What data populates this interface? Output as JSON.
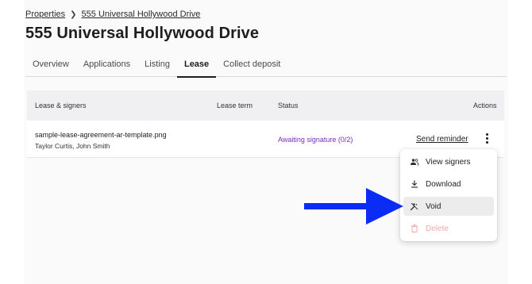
{
  "breadcrumb": {
    "parent": "Properties",
    "current": "555 Universal Hollywood Drive"
  },
  "page": {
    "title": "555 Universal Hollywood Drive"
  },
  "tabs": [
    {
      "label": "Overview",
      "active": false
    },
    {
      "label": "Applications",
      "active": false
    },
    {
      "label": "Listing",
      "active": false
    },
    {
      "label": "Lease",
      "active": true
    },
    {
      "label": "Collect deposit",
      "active": false
    }
  ],
  "table": {
    "headers": {
      "lease_signers": "Lease & signers",
      "lease_term": "Lease term",
      "status": "Status",
      "actions": "Actions"
    },
    "rows": [
      {
        "file_name": "sample-lease-agreement-ar-template.png",
        "signers": "Taylor Curtis, John Smith",
        "lease_term": "",
        "status": "Awaiting signature (0/2)",
        "action_label": "Send reminder"
      }
    ]
  },
  "menu": {
    "items": [
      {
        "label": "View signers",
        "icon": "people-icon",
        "disabled": false
      },
      {
        "label": "Download",
        "icon": "download-icon",
        "disabled": false
      },
      {
        "label": "Void",
        "icon": "void-icon",
        "disabled": false,
        "highlighted": true
      },
      {
        "label": "Delete",
        "icon": "trash-icon",
        "disabled": true
      }
    ]
  },
  "colors": {
    "status_text": "#7a2fc0",
    "arrow": "#0a2cf5",
    "disabled_text": "#f0a9a9",
    "header_bg": "#f0f0f3"
  }
}
